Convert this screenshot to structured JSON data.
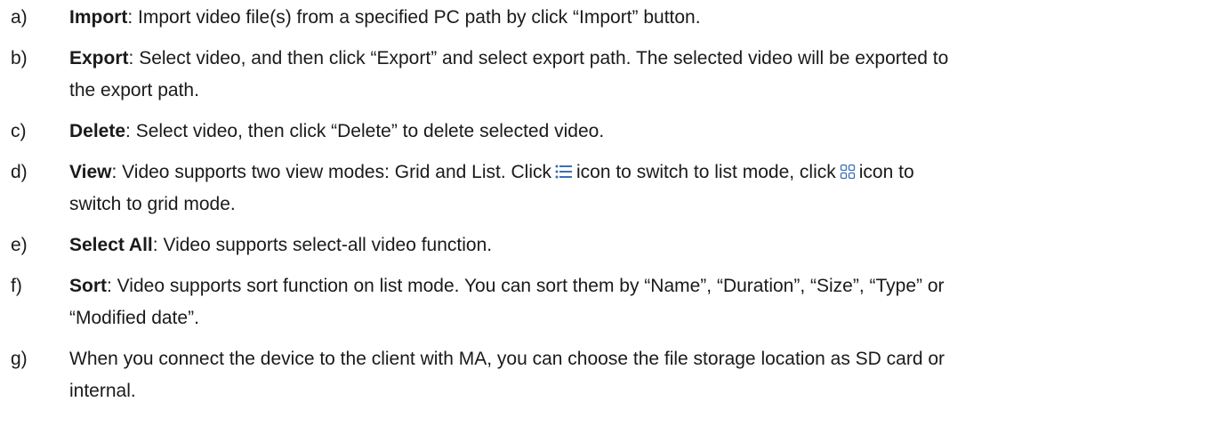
{
  "items": [
    {
      "marker": "a)",
      "label": "Import",
      "lines": [
        "Import video file(s) from a specified PC path by click “Import” button."
      ]
    },
    {
      "marker": "b)",
      "label": "Export",
      "lines": [
        "Select video, and then click “Export” and select export path.  The selected video will be exported to",
        "the export path."
      ]
    },
    {
      "marker": "c)",
      "label": "Delete",
      "lines": [
        "Select video, then click “Delete” to delete selected video."
      ]
    },
    {
      "marker": "d)",
      "label": "View",
      "part1": "Video supports two view modes: Grid and List. Click",
      "part2": "icon to switch to list mode, click",
      "part3": "icon to",
      "line2": "switch to grid mode.",
      "icons": [
        "list-view-icon",
        "grid-view-icon"
      ]
    },
    {
      "marker": "e)",
      "label": "Select All",
      "lines": [
        "Video supports select-all video function."
      ]
    },
    {
      "marker": "f)",
      "label": "Sort",
      "lines": [
        "Video supports sort function on list mode. You can sort them by “Name”, “Duration”, “Size”, “Type” or",
        "“Modified date”."
      ]
    },
    {
      "marker": "g)",
      "label": "",
      "lines": [
        "When you connect the device to the client with MA, you can choose the file storage location as SD card or",
        "internal."
      ]
    }
  ],
  "colors": {
    "text": "#1a1a1a",
    "icon": "#3b6fb6"
  }
}
